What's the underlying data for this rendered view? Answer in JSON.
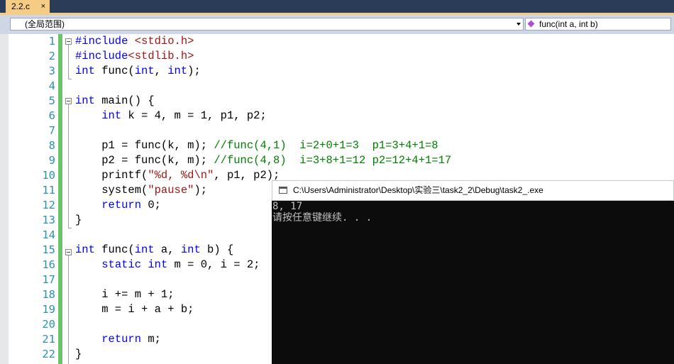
{
  "tab": {
    "label": "2.2.c",
    "close": "×"
  },
  "navbar": {
    "scope": "(全局范围)",
    "member": "func(int a, int b)"
  },
  "editor": {
    "line_numbers": [
      "1",
      "2",
      "3",
      "4",
      "5",
      "6",
      "7",
      "8",
      "9",
      "10",
      "11",
      "12",
      "13",
      "14",
      "15",
      "16",
      "17",
      "18",
      "19",
      "20",
      "21",
      "22"
    ],
    "lines": [
      [
        {
          "t": "#include ",
          "c": "pp"
        },
        {
          "t": "<stdio.h>",
          "c": "inc"
        }
      ],
      [
        {
          "t": "#include",
          "c": "pp"
        },
        {
          "t": "<stdlib.h>",
          "c": "inc"
        }
      ],
      [
        {
          "t": "int",
          "c": "kw"
        },
        {
          "t": " func("
        },
        {
          "t": "int",
          "c": "kw"
        },
        {
          "t": ", "
        },
        {
          "t": "int",
          "c": "kw"
        },
        {
          "t": ");"
        }
      ],
      [],
      [
        {
          "t": "int",
          "c": "kw"
        },
        {
          "t": " main() {"
        }
      ],
      [
        {
          "t": "    "
        },
        {
          "t": "int",
          "c": "kw"
        },
        {
          "t": " k = 4, m = 1, p1, p2;"
        }
      ],
      [],
      [
        {
          "t": "    p1 = func(k, m); "
        },
        {
          "t": "//func(4,1)  i=2+0+1=3  p1=3+4+1=8",
          "c": "cm"
        }
      ],
      [
        {
          "t": "    p2 = func(k, m); "
        },
        {
          "t": "//func(4,8)  i=3+8+1=12 p2=12+4+1=17",
          "c": "cm"
        }
      ],
      [
        {
          "t": "    printf("
        },
        {
          "t": "\"%d, %d\\n\"",
          "c": "str"
        },
        {
          "t": ", p1, p2);"
        }
      ],
      [
        {
          "t": "    system("
        },
        {
          "t": "\"pause\"",
          "c": "str"
        },
        {
          "t": ");"
        }
      ],
      [
        {
          "t": "    "
        },
        {
          "t": "return",
          "c": "kw"
        },
        {
          "t": " 0;"
        }
      ],
      [
        {
          "t": "}"
        }
      ],
      [],
      [
        {
          "t": "int",
          "c": "kw"
        },
        {
          "t": " func("
        },
        {
          "t": "int",
          "c": "kw"
        },
        {
          "t": " a, "
        },
        {
          "t": "int",
          "c": "kw"
        },
        {
          "t": " b) {"
        }
      ],
      [
        {
          "t": "    "
        },
        {
          "t": "static",
          "c": "kw"
        },
        {
          "t": " "
        },
        {
          "t": "int",
          "c": "kw"
        },
        {
          "t": " m = 0, i = 2;"
        }
      ],
      [],
      [
        {
          "t": "    i += m + 1;"
        }
      ],
      [
        {
          "t": "    m = i + a + b;"
        }
      ],
      [],
      [
        {
          "t": "    "
        },
        {
          "t": "return",
          "c": "kw"
        },
        {
          "t": " m;"
        }
      ],
      [
        {
          "t": "}"
        }
      ]
    ]
  },
  "console": {
    "title": "C:\\Users\\Administrator\\Desktop\\实验三\\task2_2\\Debug\\task2_.exe",
    "output": [
      "8, 17",
      "请按任意键继续. . ."
    ]
  }
}
